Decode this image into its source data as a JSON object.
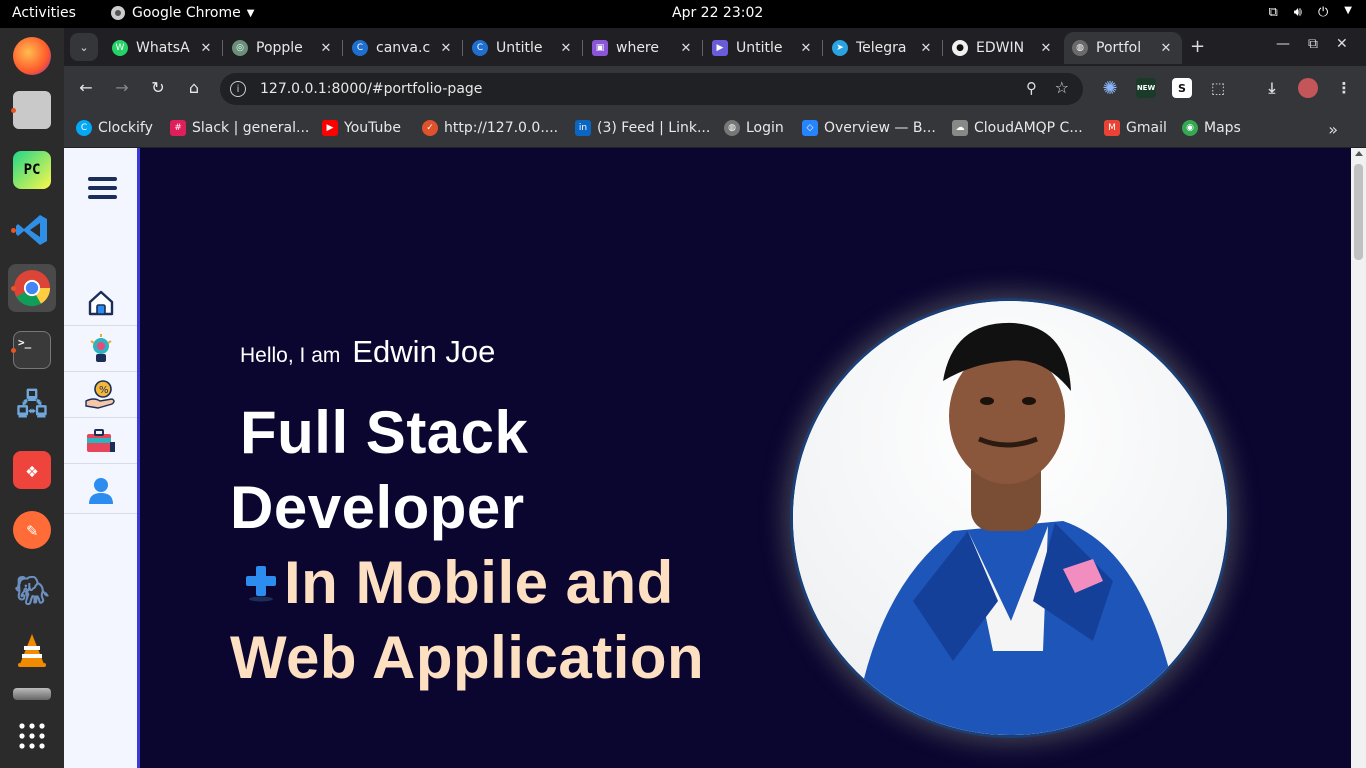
{
  "system": {
    "activities": "Activities",
    "app_name": "Google Chrome",
    "clock": "Apr 22  23:02"
  },
  "tabs": [
    {
      "title": "WhatsA",
      "fav_color": "#25d366",
      "fav_glyph": "W"
    },
    {
      "title": "Popple",
      "fav_color": "#6b8f7a",
      "fav_glyph": "◎"
    },
    {
      "title": "canva.c",
      "fav_color": "#1f6fd1",
      "fav_glyph": "C"
    },
    {
      "title": "Untitle",
      "fav_color": "#1f6fd1",
      "fav_glyph": "C"
    },
    {
      "title": "where",
      "fav_color": "#8a55d6",
      "fav_glyph": "▣"
    },
    {
      "title": "Untitle",
      "fav_color": "#6a5cd8",
      "fav_glyph": "▶"
    },
    {
      "title": "Telegra",
      "fav_color": "#2aa3e0",
      "fav_glyph": "➤"
    },
    {
      "title": "EDWIN",
      "fav_color": "#333333",
      "fav_glyph": "●"
    },
    {
      "title": "Portfol",
      "fav_color": "#6a6a6a",
      "fav_glyph": "◍",
      "active": true
    }
  ],
  "address_bar": {
    "url": "127.0.0.1:8000/#portfolio-page"
  },
  "bookmarks": [
    {
      "label": "Clockify",
      "icon_color": "#03a9f4",
      "glyph": "C"
    },
    {
      "label": "Slack | general...",
      "icon_color": "#e01e5a",
      "glyph": "#"
    },
    {
      "label": "YouTube",
      "icon_color": "#ff0000",
      "glyph": "▶"
    },
    {
      "label": "http://127.0.0....",
      "icon_color": "#e0522b",
      "glyph": "✓"
    },
    {
      "label": "(3) Feed | Link...",
      "icon_color": "#0a66c2",
      "glyph": "in"
    },
    {
      "label": "Login",
      "icon_color": "#777777",
      "glyph": "◍"
    },
    {
      "label": "Overview — B...",
      "icon_color": "#2684ff",
      "glyph": "◇"
    },
    {
      "label": "CloudAMQP C...",
      "icon_color": "#888888",
      "glyph": "☁"
    },
    {
      "label": "Gmail",
      "icon_color": "#ea4335",
      "glyph": "M"
    },
    {
      "label": "Maps",
      "icon_color": "#34a853",
      "glyph": "◉"
    }
  ],
  "hero": {
    "greeting": "Hello, I am",
    "name": "Edwin Joe",
    "line1": "Full Stack",
    "line2": "Developer",
    "line3": "In Mobile and",
    "line4": "Web Application"
  },
  "colors": {
    "page_bg": "#0b0630",
    "accent_peach": "#fde0c2",
    "nav_accent": "#3c39d9"
  },
  "side_nav": [
    "home-icon",
    "skills-icon",
    "services-icon",
    "portfolio-icon",
    "profile-icon"
  ]
}
